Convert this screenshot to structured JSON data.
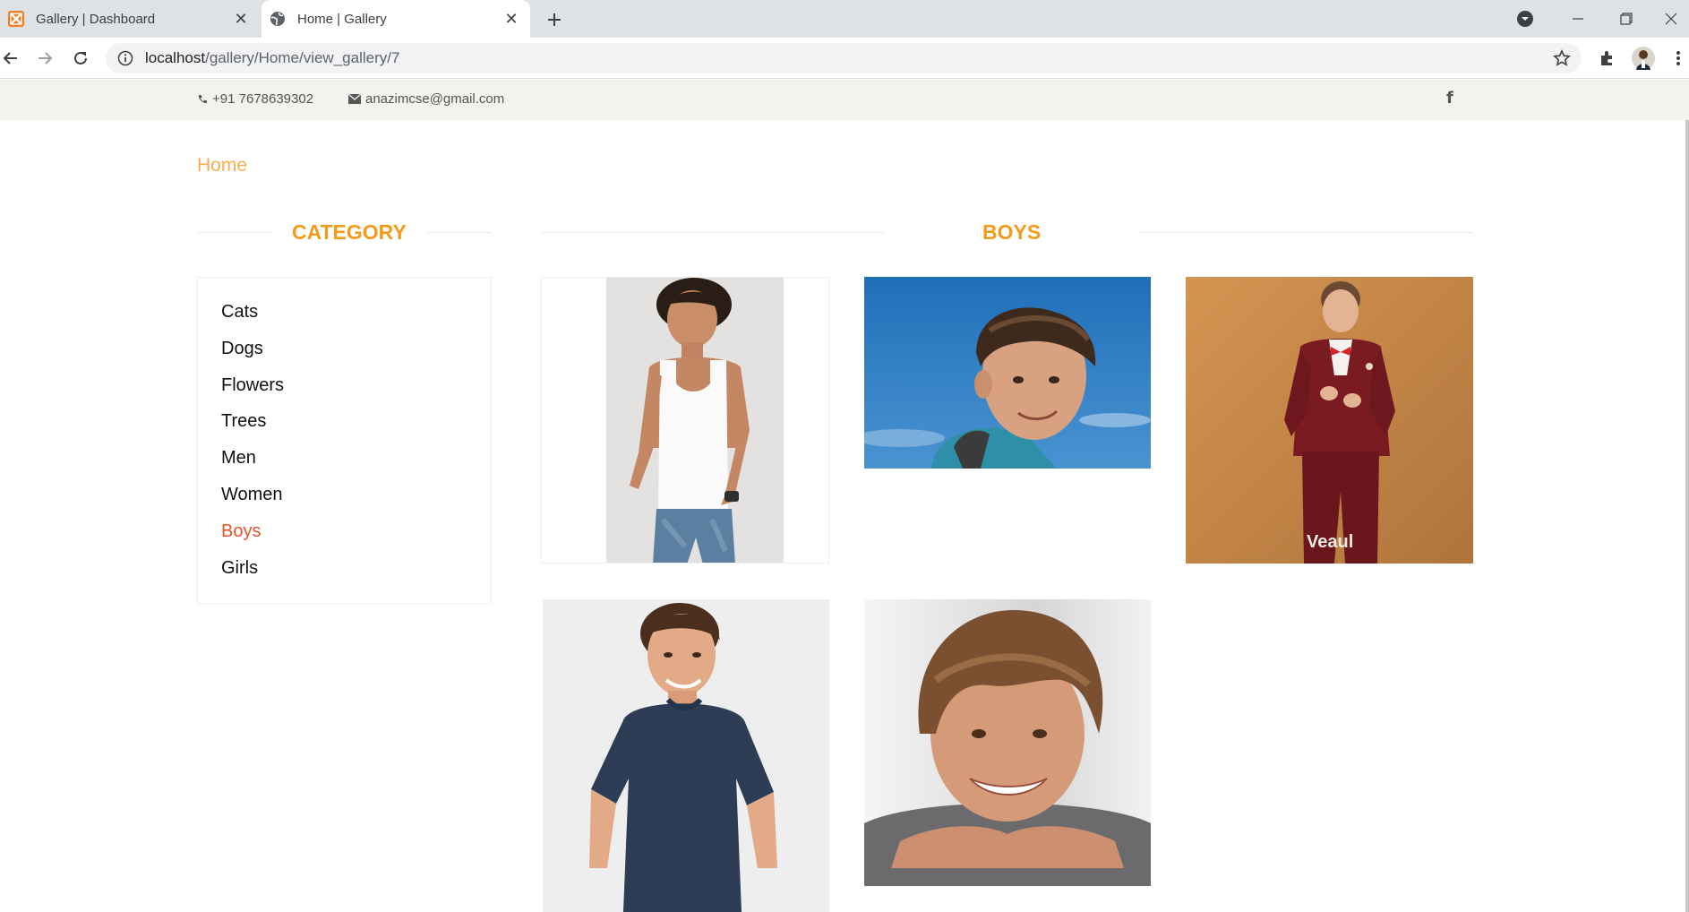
{
  "browser": {
    "tabs": [
      {
        "title": "Gallery | Dashboard",
        "active": false,
        "favicon": "xampp-icon"
      },
      {
        "title": "Home | Gallery",
        "active": true,
        "favicon": "globe-icon"
      }
    ],
    "url_host": "localhost",
    "url_path": "/gallery/Home/view_gallery/7"
  },
  "topbar": {
    "phone": "+91 7678639302",
    "email": "anazimcse@gmail.com",
    "social_icon": "facebook-icon"
  },
  "breadcrumb": "Home",
  "sidebar": {
    "heading": "CATEGORY",
    "items": [
      {
        "label": "Cats"
      },
      {
        "label": "Dogs"
      },
      {
        "label": "Flowers"
      },
      {
        "label": "Trees"
      },
      {
        "label": "Men"
      },
      {
        "label": "Women"
      },
      {
        "label": "Boys",
        "active": true
      },
      {
        "label": "Girls"
      }
    ]
  },
  "gallery": {
    "heading": "BOYS",
    "photos": [
      {
        "description": "boy in white tank top",
        "watermark": ""
      },
      {
        "description": "boy against blue sky",
        "watermark": ""
      },
      {
        "description": "boy in red suit",
        "watermark": "Veaul"
      },
      {
        "description": "boy in navy t-shirt",
        "watermark": ""
      },
      {
        "description": "smiling boy close-up",
        "watermark": ""
      }
    ]
  },
  "colors": {
    "accent": "#f29b1d",
    "breadcrumb": "#f6ae4e",
    "active_item": "#e5542d",
    "topbar_bg": "#f3f2ee"
  }
}
